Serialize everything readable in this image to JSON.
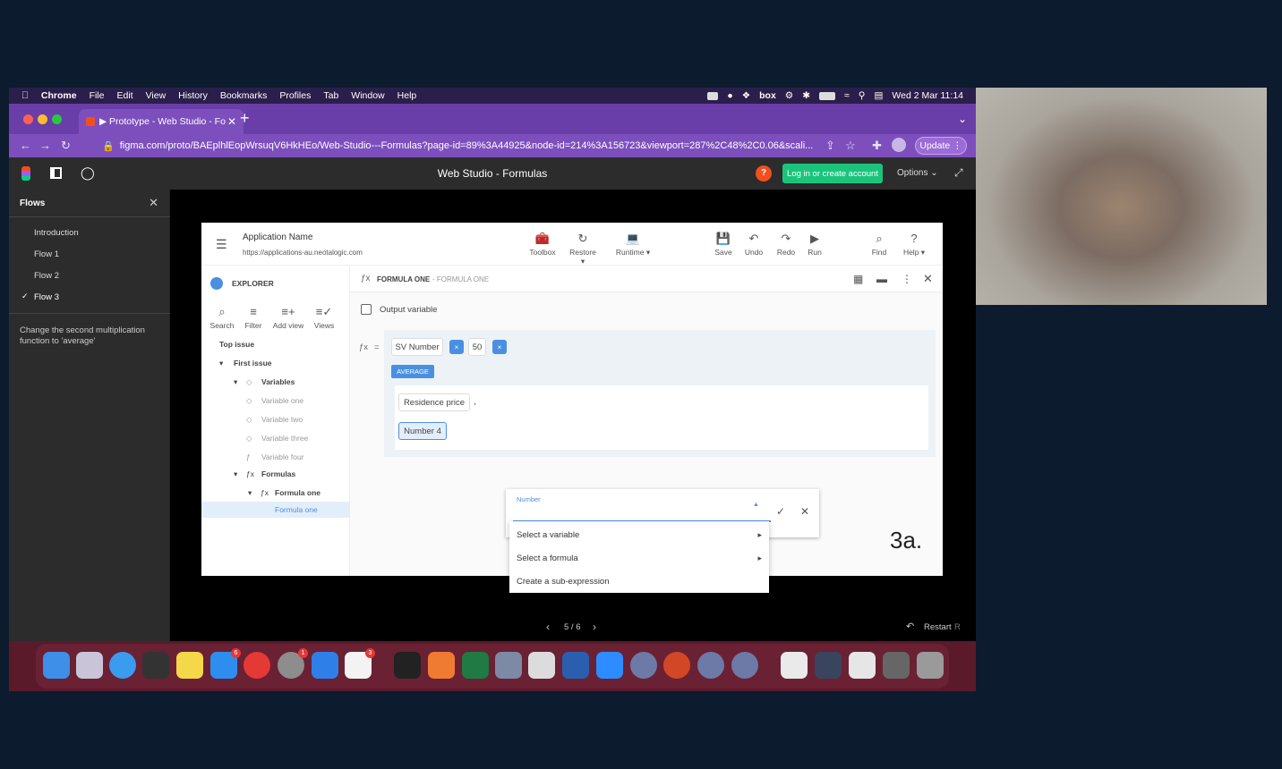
{
  "menubar": {
    "apple": "",
    "items": [
      "Chrome",
      "File",
      "Edit",
      "View",
      "History",
      "Bookmarks",
      "Profiles",
      "Tab",
      "Window",
      "Help"
    ],
    "clock": "Wed 2 Mar  11:14",
    "box": "box"
  },
  "browser": {
    "tab_title": "▶ Prototype - Web Studio - Fo",
    "url": "figma.com/proto/BAEplhlEopWrsuqV6HkHEo/Web-Studio---Formulas?page-id=89%3A44925&node-id=214%3A156723&viewport=287%2C48%2C0.06&scali...",
    "update_label": "Update"
  },
  "figma": {
    "title": "Web Studio - Formulas",
    "login_label": "Log in or create account",
    "options_label": "Options",
    "help_label": "?"
  },
  "flows": {
    "header": "Flows",
    "items": [
      "Introduction",
      "Flow 1",
      "Flow 2",
      "Flow 3"
    ],
    "description": "Change the second multiplication function to 'average'"
  },
  "pager": {
    "page": "5 / 6",
    "restart": "Restart",
    "restart_key": "R"
  },
  "app": {
    "name": "Application Name",
    "url": "https://applications-au.neotalogic.com",
    "tools": [
      {
        "label": "Toolbox",
        "icon": "toolbox-icon"
      },
      {
        "label": "Restore",
        "icon": "restore-icon"
      },
      {
        "label": "Runtime",
        "icon": "laptop-icon"
      },
      {
        "label": "Save",
        "icon": "save-icon"
      },
      {
        "label": "Undo",
        "icon": "undo-icon"
      },
      {
        "label": "Redo",
        "icon": "redo-icon"
      },
      {
        "label": "Run",
        "icon": "play-icon"
      },
      {
        "label": "Find",
        "icon": "search-icon"
      },
      {
        "label": "Help",
        "icon": "help-icon"
      }
    ],
    "explorer": {
      "title": "EXPLORER",
      "actions": [
        "Search",
        "Filter",
        "Add view",
        "Views"
      ],
      "tree": [
        "Top issue",
        "First issue",
        "Variables",
        "Variable one",
        "Variable two",
        "Variable three",
        "Variable four",
        "Formulas",
        "Formula one",
        "Formula one"
      ]
    },
    "formula": {
      "breadcrumb_main": "FORMULA ONE",
      "breadcrumb_sub": "- FORMULA ONE",
      "output_variable": "Output variable",
      "fx": "ƒx",
      "equals": "=",
      "chip1": "SV Number",
      "times": "×",
      "chip2": "50",
      "average_label": "AVERAGE",
      "arg1": "Residence price",
      "comma": ",",
      "arg2": "Number 4",
      "dropdown_label": "Number",
      "menu": [
        "Select a variable",
        "Select a formula",
        "Create a sub-expression"
      ],
      "step_label": "3a."
    }
  }
}
